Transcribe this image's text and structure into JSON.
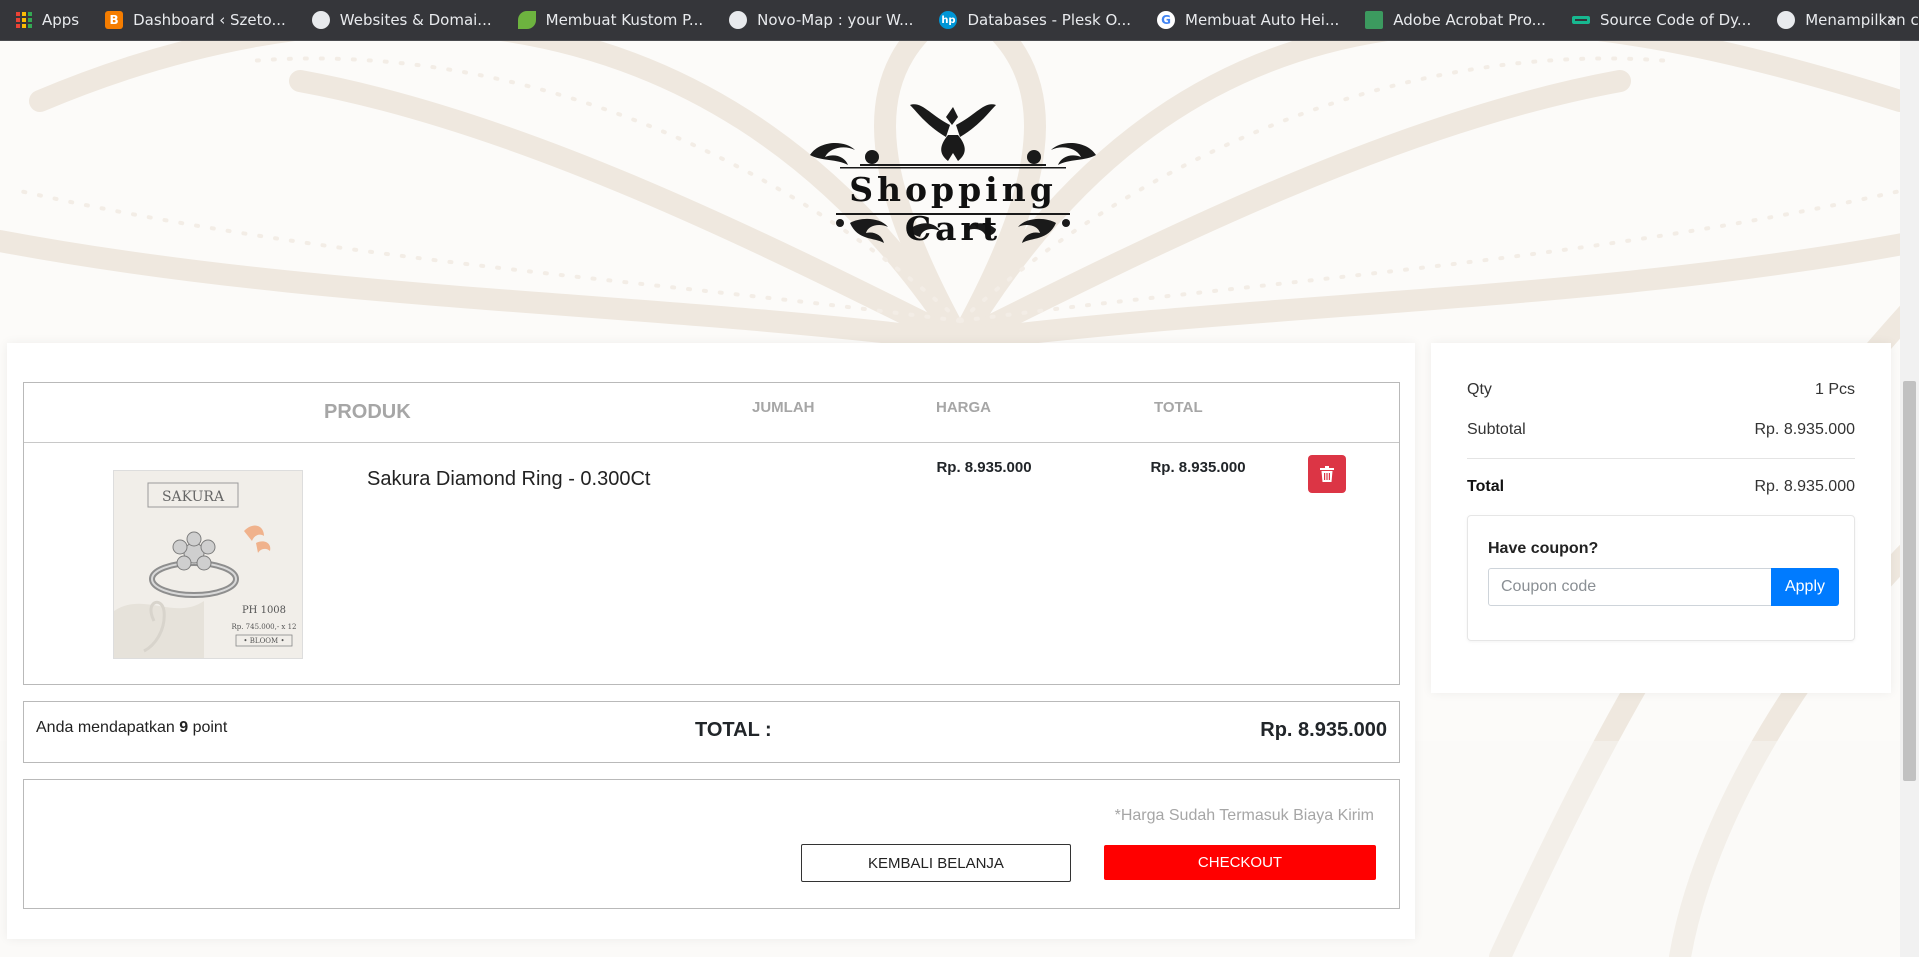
{
  "bookmarks": {
    "items": [
      {
        "label": "Apps",
        "icon": "apps-grid-icon"
      },
      {
        "label": "Dashboard ‹ Szeto...",
        "icon": "blogger-icon"
      },
      {
        "label": "Websites & Domai...",
        "icon": "globe-icon"
      },
      {
        "label": "Membuat Kustom P...",
        "icon": "leaf-icon"
      },
      {
        "label": "Novo-Map : your W...",
        "icon": "globe-icon"
      },
      {
        "label": "Databases - Plesk O...",
        "icon": "hp-icon"
      },
      {
        "label": "Membuat Auto Hei...",
        "icon": "google-icon"
      },
      {
        "label": "Adobe Acrobat Pro...",
        "icon": "acrobat-icon"
      },
      {
        "label": "Source Code of Dy...",
        "icon": "code-icon"
      },
      {
        "label": "Menampilkan chec...",
        "icon": "globe-icon"
      }
    ],
    "more": "»"
  },
  "header": {
    "logo_title": "Shopping Cart"
  },
  "cart": {
    "columns": {
      "produk": "PRODUK",
      "jumlah": "JUMLAH",
      "harga": "HARGA",
      "total": "TOTAL"
    },
    "items": [
      {
        "name": "Sakura Diamond Ring - 0.300Ct",
        "price": "Rp. 8.935.000",
        "total": "Rp. 8.935.000",
        "image_text": {
          "brand": "SAKURA",
          "code": "PH 1008",
          "price_line": "Rp. 745.000,- x 12",
          "tag": "• BLOOM •"
        }
      }
    ]
  },
  "totals": {
    "points_prefix": "Anda mendapatkan ",
    "points_value": "9",
    "points_suffix": " point",
    "label": "TOTAL :",
    "value": "Rp. 8.935.000"
  },
  "actions": {
    "shipping_note": "*Harga Sudah Termasuk Biaya Kirim",
    "back_label": "KEMBALI BELANJA",
    "checkout_label": "CHECKOUT"
  },
  "summary": {
    "qty_label": "Qty",
    "qty_value": "1 Pcs",
    "subtotal_label": "Subtotal",
    "subtotal_value": "Rp. 8.935.000",
    "total_label": "Total",
    "total_value": "Rp. 8.935.000",
    "coupon_title": "Have coupon?",
    "coupon_placeholder": "Coupon code",
    "apply_label": "Apply"
  },
  "colors": {
    "checkout": "#ff0000",
    "delete": "#dc3545",
    "apply": "#007bff"
  }
}
